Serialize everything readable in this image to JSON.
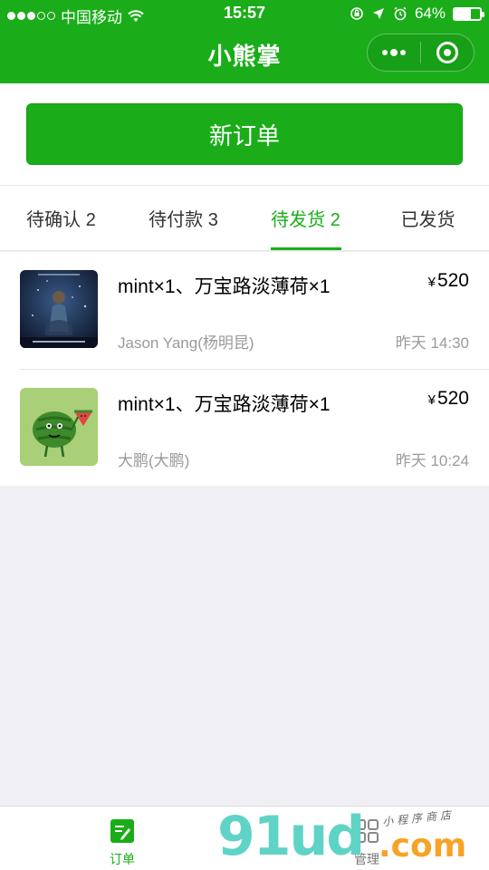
{
  "status_bar": {
    "carrier": "中国移动",
    "time": "15:57",
    "battery": "64%",
    "battery_level": 0.64
  },
  "nav": {
    "title": "小熊掌",
    "more_icon": "more-dots-icon",
    "close_icon": "target-icon"
  },
  "new_order_label": "新订单",
  "tabs": [
    {
      "label": "待确认 2",
      "active": false
    },
    {
      "label": "待付款 3",
      "active": false
    },
    {
      "label": "待发货 2",
      "active": true
    },
    {
      "label": "已发货",
      "active": false
    }
  ],
  "orders": [
    {
      "title": "mint×1、万宝路淡薄荷×1",
      "currency": "¥",
      "price": "520",
      "buyer": "Jason Yang(杨明昆)",
      "time": "昨天 14:30",
      "thumb": "album-cover-image"
    },
    {
      "title": "mint×1、万宝路淡薄荷×1",
      "currency": "¥",
      "price": "520",
      "buyer": "大鹏(大鹏)",
      "time": "昨天 10:24",
      "thumb": "watermelon-cartoon-image"
    }
  ],
  "bottom_tabs": [
    {
      "label": "订单",
      "icon": "order-edit-icon",
      "active": true
    },
    {
      "label": "管理",
      "icon": "grid-manage-icon",
      "active": false
    }
  ],
  "watermark": {
    "main": "91ud",
    "com": ".com",
    "small": "小程序商店"
  },
  "colors": {
    "accent": "#1aad19",
    "background": "#efeff4"
  }
}
